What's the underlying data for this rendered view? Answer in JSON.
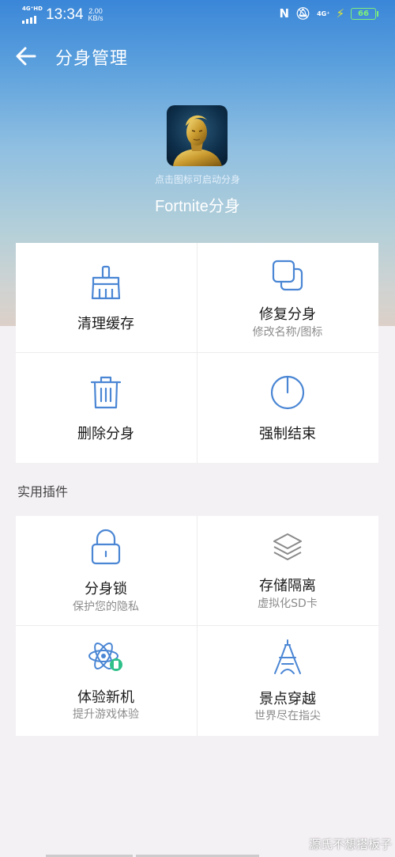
{
  "status_bar": {
    "network_left": "4G⁺HD",
    "time": "13:34",
    "speed_value": "2.00",
    "speed_unit": "KB/s",
    "network_right": "4G⁺",
    "battery": "66"
  },
  "header": {
    "title": "分身管理"
  },
  "app": {
    "hint": "点击图标可启动分身",
    "name": "Fortnite分身"
  },
  "actions": [
    {
      "label": "清理缓存",
      "icon": "broom-icon"
    },
    {
      "label": "修复分身",
      "sub": "修改名称/图标",
      "icon": "copy-icon"
    },
    {
      "label": "删除分身",
      "icon": "trash-icon"
    },
    {
      "label": "强制结束",
      "icon": "power-icon"
    }
  ],
  "plugins_section": {
    "title": "实用插件"
  },
  "plugins": [
    {
      "label": "分身锁",
      "sub": "保护您的隐私",
      "icon": "lock-icon"
    },
    {
      "label": "存储隔离",
      "sub": "虚拟化SD卡",
      "icon": "layers-icon"
    },
    {
      "label": "体验新机",
      "sub": "提升游戏体验",
      "icon": "atom-phone-icon"
    },
    {
      "label": "景点穿越",
      "sub": "世界尽在指尖",
      "icon": "eiffel-tower-icon"
    }
  ],
  "watermark": "源氏不想搭板子",
  "colors": {
    "accent": "#4a86d4",
    "header_top": "#3a86d8",
    "battery": "#7df078"
  }
}
